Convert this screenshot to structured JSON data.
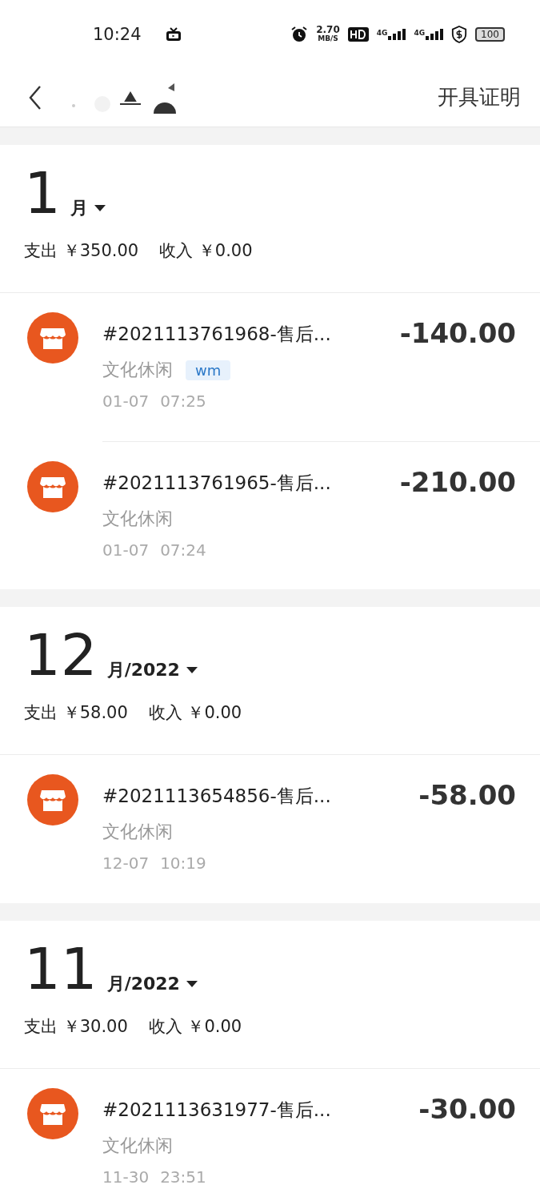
{
  "status_bar": {
    "time": "10:24",
    "speed_value": "2.70",
    "speed_unit": "MB/S",
    "network_1": "4G",
    "network_2": "4G",
    "battery": "100"
  },
  "header": {
    "action": "开具证明"
  },
  "sections": [
    {
      "month": "1",
      "suffix": "月",
      "expense": "支出 ￥350.00",
      "income": "收入 ￥0.00",
      "items": [
        {
          "title": "#2021113761968-售后...",
          "category": "文化休闲",
          "tag": "wm",
          "date": "01-07",
          "time": "07:25",
          "amount": "-140.00"
        },
        {
          "title": "#2021113761965-售后...",
          "category": "文化休闲",
          "date": "01-07",
          "time": "07:24",
          "amount": "-210.00"
        }
      ]
    },
    {
      "month": "12",
      "suffix": "月/2022",
      "expense": "支出 ￥58.00",
      "income": "收入 ￥0.00",
      "items": [
        {
          "title": "#2021113654856-售后...",
          "category": "文化休闲",
          "date": "12-07",
          "time": "10:19",
          "amount": "-58.00"
        }
      ]
    },
    {
      "month": "11",
      "suffix": "月/2022",
      "expense": "支出 ￥30.00",
      "income": "收入 ￥0.00",
      "items": [
        {
          "title": "#2021113631977-售后...",
          "category": "文化休闲",
          "date": "11-30",
          "time": "23:51",
          "amount": "-30.00"
        }
      ]
    }
  ]
}
